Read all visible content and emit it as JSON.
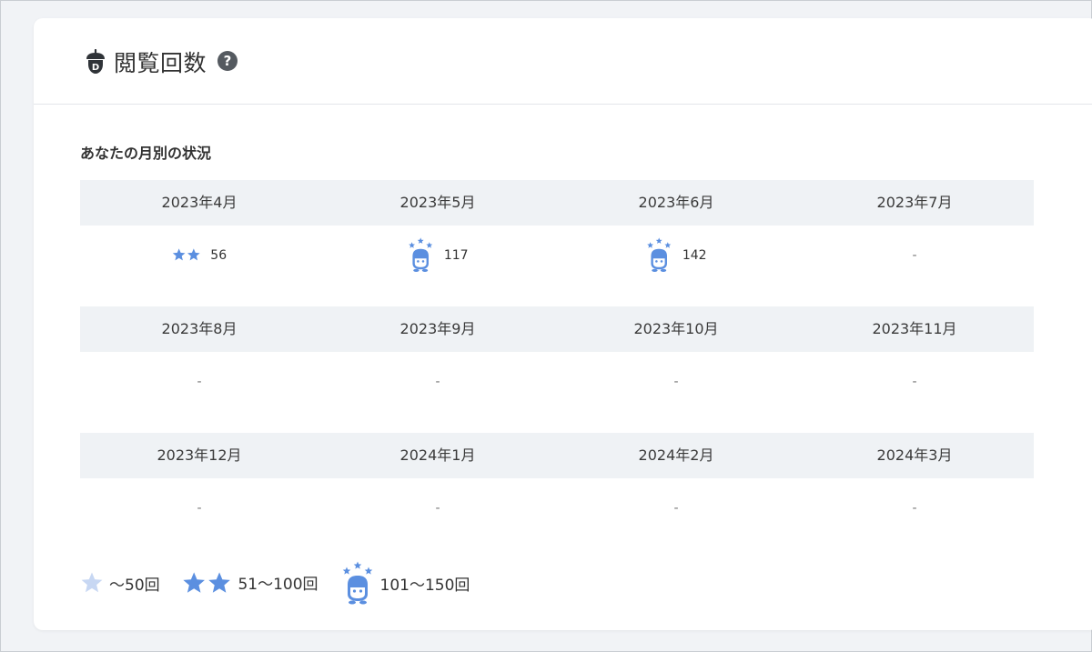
{
  "header": {
    "title": "閲覧回数",
    "help_glyph": "?",
    "logo_icon": "acorn-logo-icon",
    "help_icon": "question-circle-icon"
  },
  "section": {
    "title": "あなたの月別の状況"
  },
  "rows": [
    {
      "months": [
        {
          "label": "2023年4月",
          "value": "56",
          "badge": "two-stars"
        },
        {
          "label": "2023年5月",
          "value": "117",
          "badge": "mascot"
        },
        {
          "label": "2023年6月",
          "value": "142",
          "badge": "mascot"
        },
        {
          "label": "2023年7月",
          "value": "-",
          "badge": "none"
        }
      ]
    },
    {
      "months": [
        {
          "label": "2023年8月",
          "value": "-",
          "badge": "none"
        },
        {
          "label": "2023年9月",
          "value": "-",
          "badge": "none"
        },
        {
          "label": "2023年10月",
          "value": "-",
          "badge": "none"
        },
        {
          "label": "2023年11月",
          "value": "-",
          "badge": "none"
        }
      ]
    },
    {
      "months": [
        {
          "label": "2023年12月",
          "value": "-",
          "badge": "none"
        },
        {
          "label": "2024年1月",
          "value": "-",
          "badge": "none"
        },
        {
          "label": "2024年2月",
          "value": "-",
          "badge": "none"
        },
        {
          "label": "2024年3月",
          "value": "-",
          "badge": "none"
        }
      ]
    }
  ],
  "legend": [
    {
      "label": "～50回",
      "badge": "one-star"
    },
    {
      "label": "51～100回",
      "badge": "two-stars"
    },
    {
      "label": "101～150回",
      "badge": "mascot"
    }
  ],
  "colors": {
    "accent_blue": "#5b8fe0",
    "light_star": "#c7d7f3",
    "header_bg": "#eff2f5"
  }
}
